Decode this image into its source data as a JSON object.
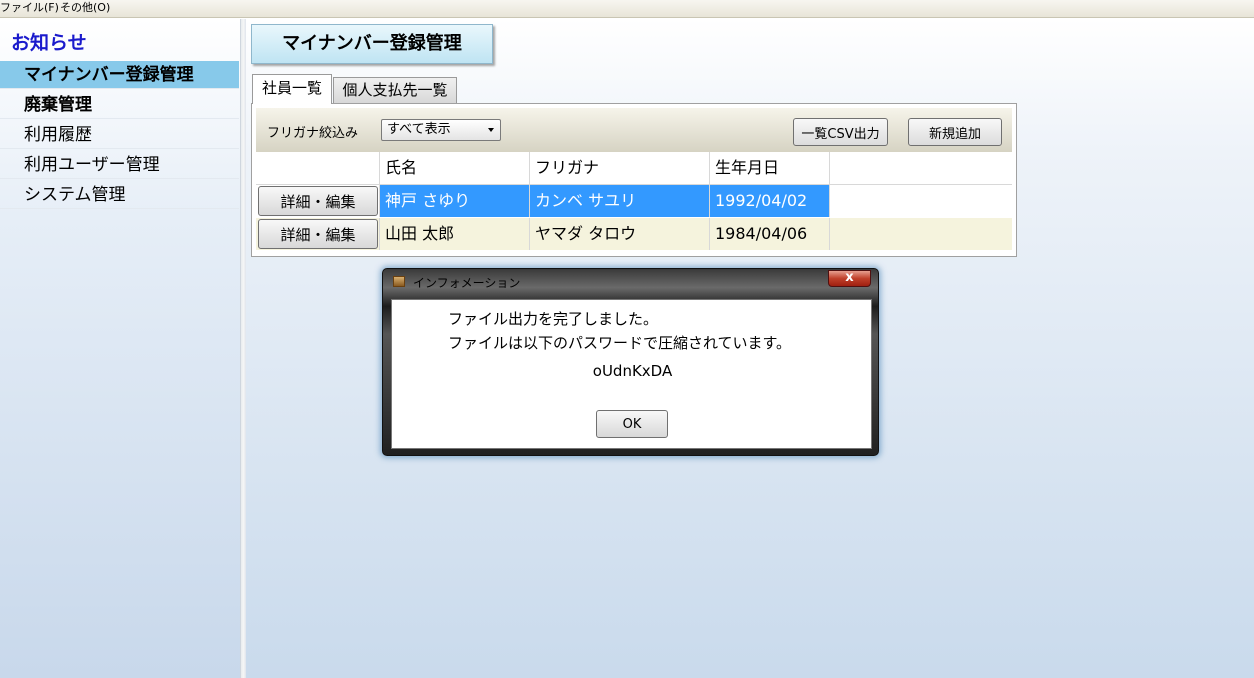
{
  "menubar": {
    "items": [
      "ファイル(F)",
      "その他(O)"
    ]
  },
  "sidebar": {
    "heading": "お知らせ",
    "items": [
      {
        "label": "マイナンバー登録管理",
        "active": true
      },
      {
        "label": "廃棄管理",
        "bold": true
      },
      {
        "label": "利用履歴"
      },
      {
        "label": "利用ユーザー管理"
      },
      {
        "label": "システム管理"
      }
    ]
  },
  "main": {
    "title": "マイナンバー登録管理",
    "tabs": [
      {
        "label": "社員一覧",
        "selected": true
      },
      {
        "label": "個人支払先一覧",
        "selected": false
      }
    ],
    "filter": {
      "label": "フリガナ絞込み",
      "selected": "すべて表示"
    },
    "buttons": {
      "csv": "一覧CSV出力",
      "new": "新規追加"
    },
    "grid": {
      "columns": [
        "",
        "氏名",
        "フリガナ",
        "生年月日"
      ],
      "rows": [
        {
          "action": "詳細・編集",
          "name": "神戸 さゆり",
          "kana": "カンベ サユリ",
          "dob": "1992/04/02",
          "selected": true
        },
        {
          "action": "詳細・編集",
          "name": "山田 太郎",
          "kana": "ヤマダ タロウ",
          "dob": "1984/04/06",
          "selected": false
        }
      ]
    }
  },
  "dialog": {
    "title": "インフォメーション",
    "close": "x",
    "message_line1": "ファイル出力を完了しました。",
    "message_line2": "ファイルは以下のパスワードで圧縮されています。",
    "password": "oUdnKxDA",
    "ok": "OK"
  },
  "colors": {
    "selected_row": "#3399ff",
    "active_sidebar": "#87c9ea",
    "heading_blue": "#1a1acc",
    "alt_row": "#f5f3dd"
  }
}
